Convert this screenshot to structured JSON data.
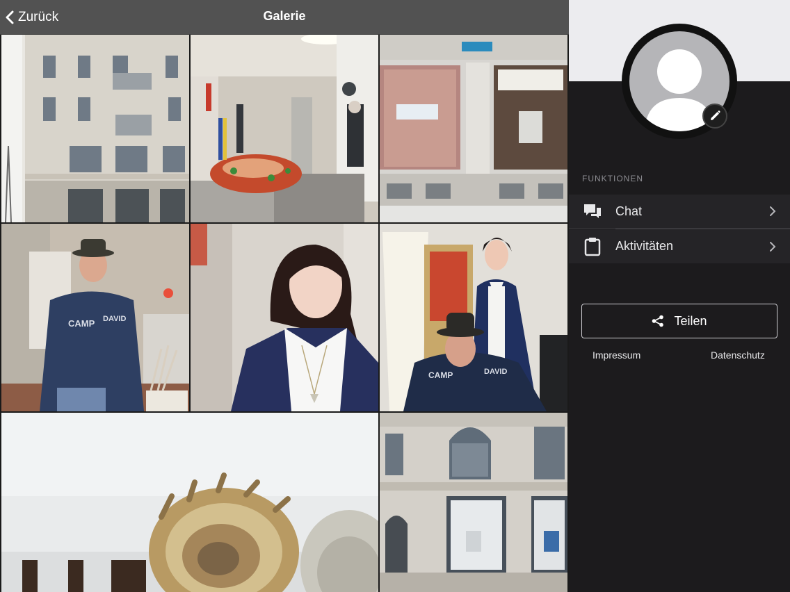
{
  "navbar": {
    "back_label": "Zurück",
    "title": "Galerie"
  },
  "gallery": {
    "tiles": [
      "building-facade-photo",
      "salon-interior-buffet-photo",
      "storefront-window-photo",
      "man-with-hat-photo",
      "woman-portrait-photo",
      "couple-in-salon-photo",
      "shell-logo-closeup-photo",
      "building-corner-photo"
    ]
  },
  "sidebar": {
    "section_label": "FUNKTIONEN",
    "menu": [
      {
        "label": "Chat",
        "icon": "chat-icon"
      },
      {
        "label": "Aktivitäten",
        "icon": "clipboard-icon"
      }
    ],
    "share_label": "Teilen",
    "impressum_label": "Impressum",
    "datenschutz_label": "Datenschutz"
  },
  "colors": {
    "navbar": "#525252",
    "sidebar": "#1c1b1d",
    "banner": "#ececef",
    "row": "#252427"
  }
}
